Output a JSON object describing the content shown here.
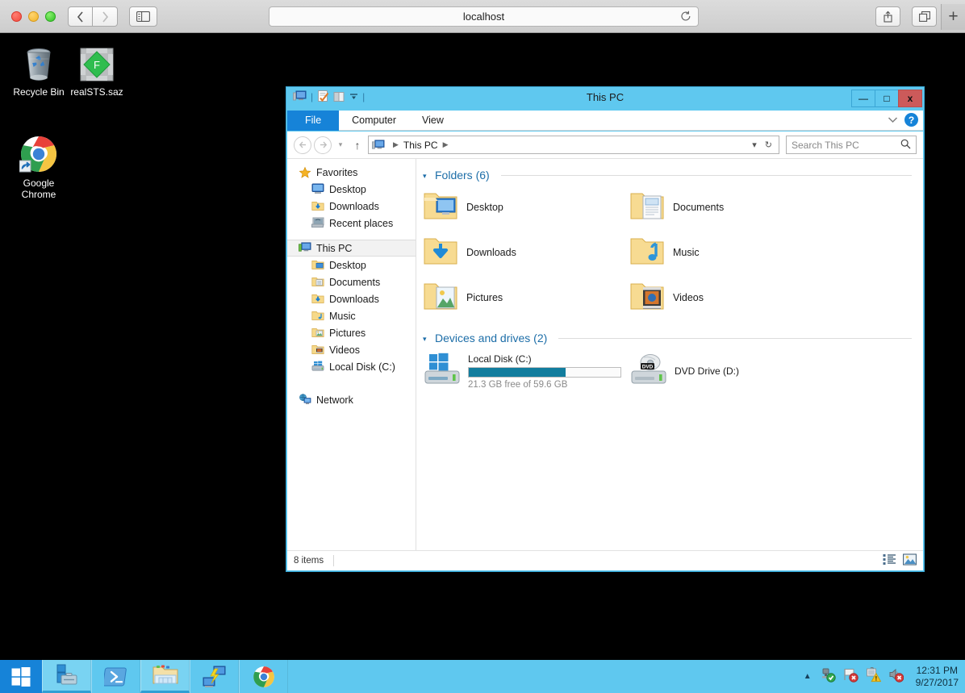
{
  "browser": {
    "url_text": "localhost",
    "back_icon": "chevron-left-icon",
    "forward_icon": "chevron-right-icon",
    "sidebar_icon": "sidebar-icon",
    "reload_icon": "reload-icon",
    "share_icon": "share-icon",
    "tabs_icon": "tab-overview-icon",
    "new_tab_label": "+"
  },
  "desktop": {
    "icons": [
      {
        "name": "Recycle Bin",
        "icon": "recycle-bin-icon"
      },
      {
        "name": "realSTS.saz",
        "icon": "fiddler-saz-file-icon"
      },
      {
        "name": "Google\nChrome",
        "label_line1": "Google",
        "label_line2": "Chrome",
        "icon": "google-chrome-icon"
      }
    ]
  },
  "explorer": {
    "title": "This PC",
    "quick_access": [
      "this-pc-icon",
      "properties-icon",
      "new-folder-icon",
      "customize-dropdown-icon"
    ],
    "window_buttons": {
      "minimize": "—",
      "maximize": "□",
      "close": "x"
    },
    "ribbon_tabs": [
      {
        "label": "File",
        "active": true
      },
      {
        "label": "Computer",
        "active": false
      },
      {
        "label": "View",
        "active": false
      }
    ],
    "ribbon_collapse_icon": "chevron-down-icon",
    "help_label": "?",
    "address": {
      "back_icon": "back-arrow-icon",
      "forward_icon": "forward-arrow-icon",
      "history_icon": "recent-locations-icon",
      "up_icon": "up-arrow-icon",
      "crumb_icon": "this-pc-icon",
      "crumb_text": "This PC",
      "dropdown_icon": "chevron-down-icon",
      "refresh_icon": "refresh-icon"
    },
    "search": {
      "placeholder": "Search This PC",
      "icon": "search-icon"
    },
    "nav_pane": [
      {
        "label": "Favorites",
        "icon": "favorites-star-icon",
        "level": 0
      },
      {
        "label": "Desktop",
        "icon": "desktop-icon",
        "level": 1
      },
      {
        "label": "Downloads",
        "icon": "downloads-folder-icon",
        "level": 1
      },
      {
        "label": "Recent places",
        "icon": "recent-places-icon",
        "level": 1
      },
      {
        "label": "This PC",
        "icon": "this-pc-icon",
        "level": 0,
        "selected": true
      },
      {
        "label": "Desktop",
        "icon": "desktop-folder-icon",
        "level": 1
      },
      {
        "label": "Documents",
        "icon": "documents-folder-icon",
        "level": 1
      },
      {
        "label": "Downloads",
        "icon": "downloads-folder-icon",
        "level": 1
      },
      {
        "label": "Music",
        "icon": "music-folder-icon",
        "level": 1
      },
      {
        "label": "Pictures",
        "icon": "pictures-folder-icon",
        "level": 1
      },
      {
        "label": "Videos",
        "icon": "videos-folder-icon",
        "level": 1
      },
      {
        "label": "Local Disk (C:)",
        "icon": "hard-drive-icon",
        "level": 1
      },
      {
        "label": "Network",
        "icon": "network-icon",
        "level": 0
      }
    ],
    "groups": {
      "folders": {
        "title": "Folders (6)",
        "items": [
          {
            "label": "Desktop",
            "icon": "desktop-folder-icon"
          },
          {
            "label": "Documents",
            "icon": "documents-folder-icon"
          },
          {
            "label": "Downloads",
            "icon": "downloads-folder-icon"
          },
          {
            "label": "Music",
            "icon": "music-folder-icon"
          },
          {
            "label": "Pictures",
            "icon": "pictures-folder-icon"
          },
          {
            "label": "Videos",
            "icon": "videos-folder-icon"
          }
        ]
      },
      "devices": {
        "title": "Devices and drives (2)",
        "items": [
          {
            "label": "Local Disk (C:)",
            "icon": "windows-drive-icon",
            "free_text": "21.3 GB free of 59.6 GB",
            "used_percent": 64,
            "bar_color": "#127d9e"
          },
          {
            "label": "DVD Drive (D:)",
            "icon": "dvd-drive-icon"
          }
        ]
      }
    },
    "status": {
      "item_count": "8 items",
      "view_details_icon": "details-view-icon",
      "view_large_icons_icon": "large-icons-view-icon"
    }
  },
  "taskbar": {
    "start_icon": "windows-start-icon",
    "items": [
      {
        "icon": "server-manager-icon",
        "active": true
      },
      {
        "icon": "powershell-icon",
        "active": false
      },
      {
        "icon": "file-explorer-icon",
        "active": true
      },
      {
        "icon": "fiddler-icon",
        "active": false
      },
      {
        "icon": "google-chrome-icon",
        "active": false
      }
    ],
    "tray": {
      "overflow_icon": "show-hidden-icons-icon",
      "icons": [
        "network-ok-icon",
        "flag-error-icon",
        "action-center-warning-icon",
        "volume-muted-icon"
      ],
      "time": "12:31 PM",
      "date": "9/27/2017"
    }
  }
}
